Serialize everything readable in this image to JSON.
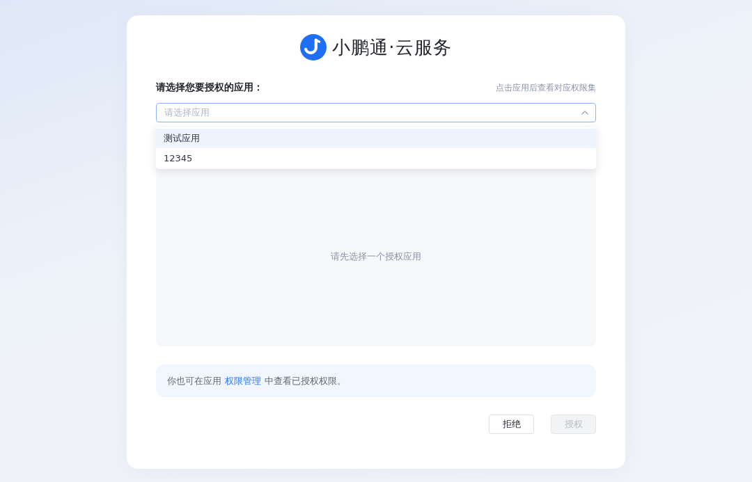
{
  "brand": {
    "name": "小鹏通·云服务"
  },
  "form": {
    "label": "请选择您要授权的应用：",
    "hint": "点击应用后查看对应权限集"
  },
  "select": {
    "placeholder": "请选择应用",
    "expanded": true,
    "options": [
      {
        "label": "测试应用",
        "highlighted": true
      },
      {
        "label": "12345",
        "highlighted": false
      }
    ]
  },
  "empty_state": {
    "text": "请先选择一个授权应用"
  },
  "note": {
    "before": "你也可在应用",
    "link": "权限管理",
    "after": "中查看已授权权限。"
  },
  "buttons": [
    {
      "label": "拒绝",
      "kind": "secondary",
      "disabled": false
    },
    {
      "label": "授权",
      "kind": "primary",
      "disabled": true
    }
  ]
}
